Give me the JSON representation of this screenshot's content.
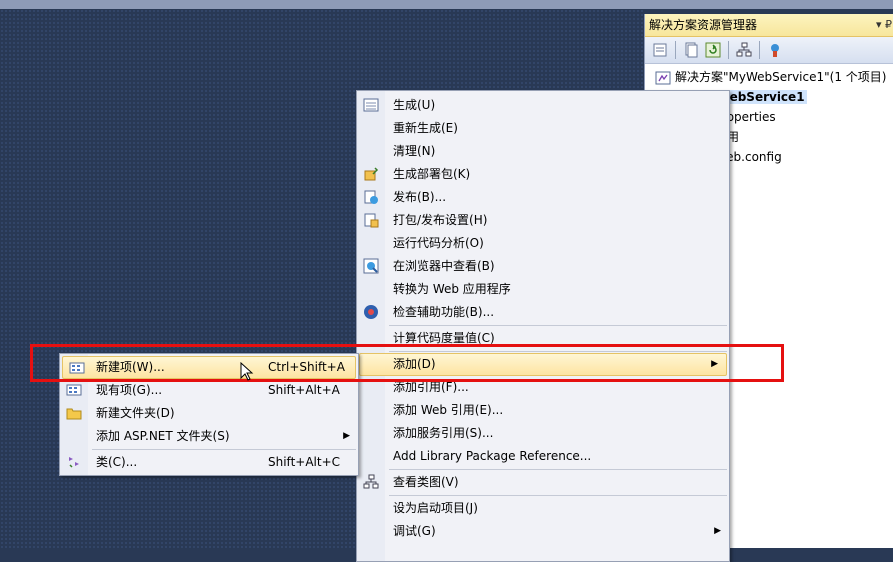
{
  "solution_explorer": {
    "title": "解决方案资源管理器",
    "title_buttons": "▾ ₽",
    "tree": [
      {
        "label": "解决方案\"MyWebService1\"(1 个项目)",
        "icon": "solution-icon"
      },
      {
        "label": "MyWebService1",
        "icon": "web-project-icon",
        "selected": true
      },
      {
        "label": "Properties",
        "icon": "properties-icon"
      },
      {
        "label": "引用",
        "icon": "references-icon"
      },
      {
        "label": "Web.config",
        "icon": "config-file-icon"
      }
    ]
  },
  "project_menu": {
    "items": [
      {
        "label": "生成(U)",
        "icon": "build-icon"
      },
      {
        "label": "重新生成(E)"
      },
      {
        "label": "清理(N)"
      },
      {
        "label": "生成部署包(K)",
        "icon": "deploy-package-icon"
      },
      {
        "label": "发布(B)...",
        "icon": "publish-icon"
      },
      {
        "label": "打包/发布设置(H)",
        "icon": "package-settings-icon"
      },
      {
        "label": "运行代码分析(O)"
      },
      {
        "label": "在浏览器中查看(B)",
        "icon": "browser-view-icon"
      },
      {
        "label": "转换为 Web 应用程序"
      },
      {
        "label": "检查辅助功能(B)...",
        "icon": "accessibility-icon"
      },
      {
        "label": "计算代码度量值(C)"
      },
      {
        "label": "添加(D)",
        "highlighted": true,
        "submenu_arrow": "▶"
      },
      {
        "label": "添加引用(F)..."
      },
      {
        "label": "添加 Web 引用(E)..."
      },
      {
        "label": "添加服务引用(S)..."
      },
      {
        "label": "Add Library Package Reference..."
      },
      {
        "label": "查看类图(V)",
        "icon": "class-diagram-icon"
      },
      {
        "label": "设为启动项目(J)"
      },
      {
        "label": "调试(G)",
        "submenu_arrow": "▶"
      }
    ]
  },
  "add_submenu": {
    "items": [
      {
        "label": "新建项(W)...",
        "shortcut": "Ctrl+Shift+A",
        "icon": "new-item-icon",
        "highlighted": true
      },
      {
        "label": "现有项(G)...",
        "shortcut": "Shift+Alt+A",
        "icon": "existing-item-icon"
      },
      {
        "label": "新建文件夹(D)",
        "icon": "new-folder-icon"
      },
      {
        "label": "添加 ASP.NET 文件夹(S)",
        "submenu_arrow": "▶"
      },
      {
        "label": "类(C)...",
        "shortcut": "Shift+Alt+C",
        "icon": "class-icon"
      }
    ]
  }
}
